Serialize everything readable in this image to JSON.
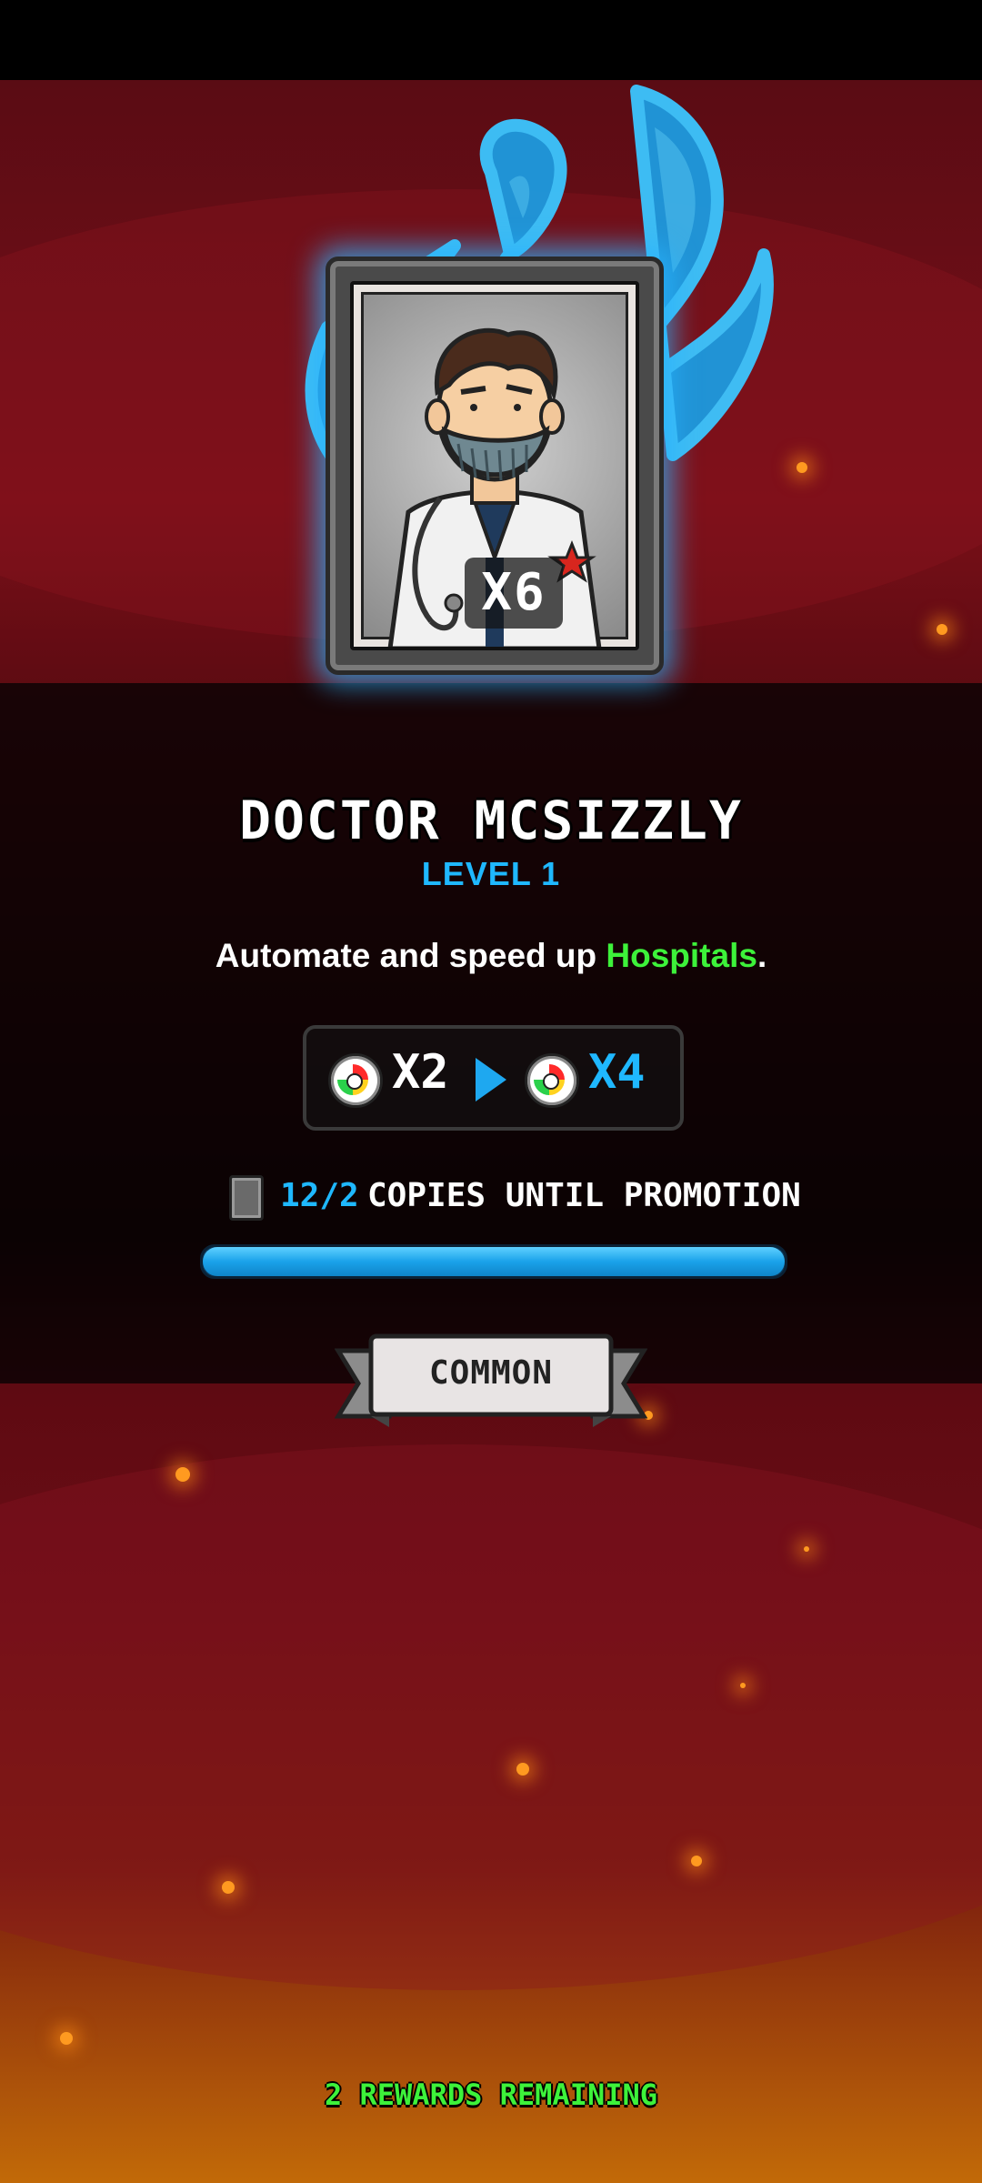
{
  "card": {
    "count": "X6",
    "name": "DOCTOR MCSIZZLY",
    "level": "LEVEL 1",
    "description_prefix": "Automate and speed up ",
    "description_highlight": "Hospitals",
    "description_suffix": "."
  },
  "boost": {
    "from": "X2",
    "to": "X4"
  },
  "promotion": {
    "count": "12/2",
    "label": "COPIES UNTIL PROMOTION",
    "progress_fraction": 1.0
  },
  "rarity": "COMMON",
  "rewards_remaining": "2 REWARDS REMAINING",
  "colors": {
    "accent_blue": "#1fb8ff",
    "highlight_green": "#3df23a",
    "glow": "#28b4ff"
  },
  "icons": {
    "speed": "speedometer-icon",
    "arrow": "arrow-right-icon",
    "card": "card-icon"
  }
}
